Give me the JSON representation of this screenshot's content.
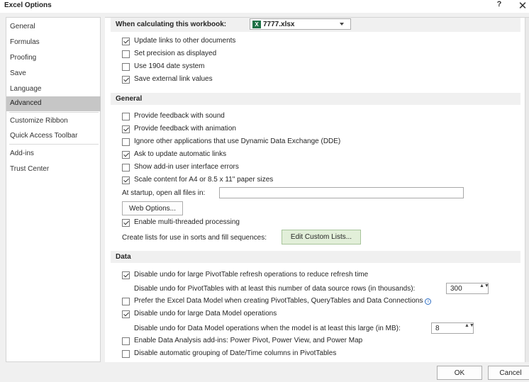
{
  "window": {
    "title": "Excel Options",
    "help": "?",
    "close": "✕"
  },
  "sidebar": {
    "items": [
      {
        "label": "General"
      },
      {
        "label": "Formulas"
      },
      {
        "label": "Proofing"
      },
      {
        "label": "Save"
      },
      {
        "label": "Language"
      },
      {
        "label": "Advanced",
        "active": true
      },
      {
        "label": "Customize Ribbon"
      },
      {
        "label": "Quick Access Toolbar"
      },
      {
        "label": "Add-ins"
      },
      {
        "label": "Trust Center"
      }
    ]
  },
  "workbook_section": {
    "header": "When calculating this workbook:",
    "workbook": "7777.xlsx",
    "xl_icon": "X",
    "options": [
      {
        "label": "Update links to other documents",
        "checked": true
      },
      {
        "label": "Set precision as displayed",
        "checked": false
      },
      {
        "label": "Use 1904 date system",
        "checked": false
      },
      {
        "label": "Save external link values",
        "checked": true
      }
    ]
  },
  "general_section": {
    "header": "General",
    "options": [
      {
        "label": "Provide feedback with sound",
        "checked": false
      },
      {
        "label": "Provide feedback with animation",
        "checked": true
      },
      {
        "label": "Ignore other applications that use Dynamic Data Exchange (DDE)",
        "checked": false
      },
      {
        "label": "Ask to update automatic links",
        "checked": true
      },
      {
        "label": "Show add-in user interface errors",
        "checked": false
      },
      {
        "label": "Scale content for A4 or 8.5 x 11\" paper sizes",
        "checked": true
      }
    ],
    "startup_label": "At startup, open all files in:",
    "startup_value": "",
    "web_options_button": "Web Options...",
    "multithread": {
      "label": "Enable multi-threaded processing",
      "checked": true
    },
    "lists_label": "Create lists for use in sorts and fill sequences:",
    "edit_lists_button": "Edit Custom Lists..."
  },
  "data_section": {
    "header": "Data",
    "disable_pivot": {
      "label": "Disable undo for large PivotTable refresh operations to reduce refresh time",
      "checked": true
    },
    "pivot_rows_label": "Disable undo for PivotTables with at least this number of data source rows (in thousands):",
    "pivot_rows_value": "300",
    "prefer_model": {
      "label": "Prefer the Excel Data Model when creating PivotTables, QueryTables and Data Connections",
      "checked": false
    },
    "info_icon": "i",
    "disable_model": {
      "label": "Disable undo for large Data Model operations",
      "checked": true
    },
    "model_size_label": "Disable undo for Data Model operations when the model is at least this large (in MB):",
    "model_size_value": "8",
    "analysis_addins": {
      "label": "Enable Data Analysis add-ins: Power Pivot, Power View, and Power Map",
      "checked": false
    },
    "auto_grouping": {
      "label": "Disable automatic grouping of Date/Time columns in PivotTables",
      "checked": false
    },
    "spin_arrows": "▲▼"
  },
  "footer": {
    "ok": "OK",
    "cancel": "Cancel"
  }
}
